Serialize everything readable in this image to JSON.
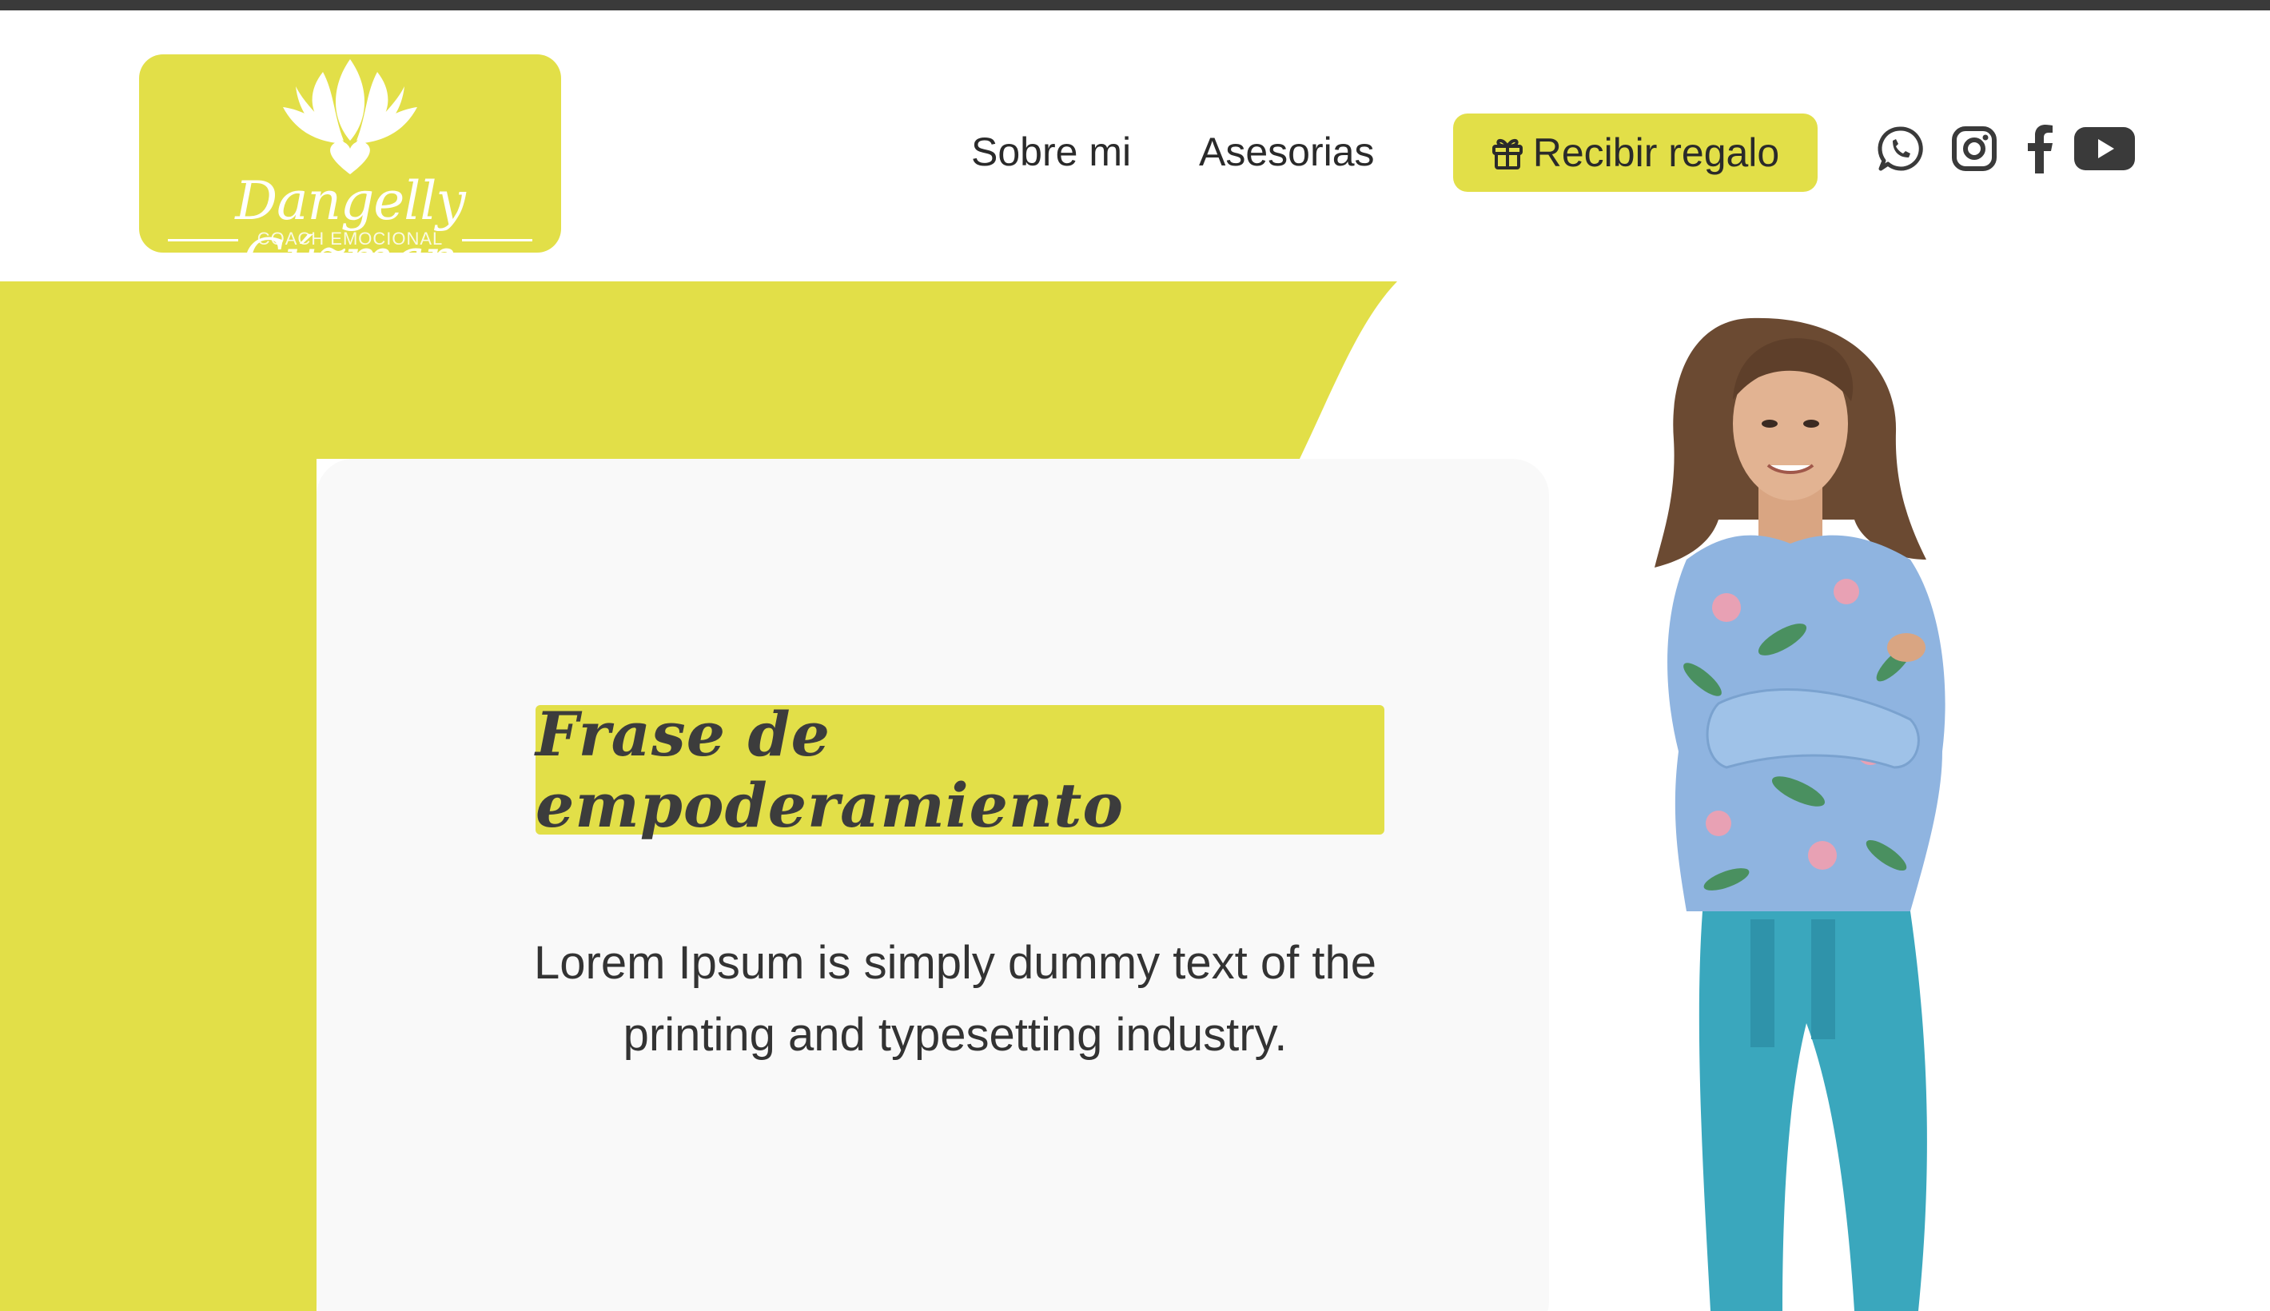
{
  "brand": {
    "logo_name": "Dangelly Gúzman",
    "logo_tagline": "COACH EMOCIONAL",
    "accent_color": "#e2df48",
    "text_color": "#2a2a2a"
  },
  "nav": {
    "items": [
      {
        "label": "Sobre mi"
      },
      {
        "label": "Asesorias"
      }
    ],
    "cta_label": "Recibir regalo",
    "cta_icon": "gift-icon"
  },
  "social": [
    {
      "icon": "whatsapp-icon"
    },
    {
      "icon": "instagram-icon"
    },
    {
      "icon": "facebook-icon"
    },
    {
      "icon": "youtube-icon"
    }
  ],
  "hero": {
    "quote": "Frase de empoderamiento",
    "body": "Lorem Ipsum is simply dummy text of the printing and typesetting industry.",
    "image": "coach-portrait"
  }
}
